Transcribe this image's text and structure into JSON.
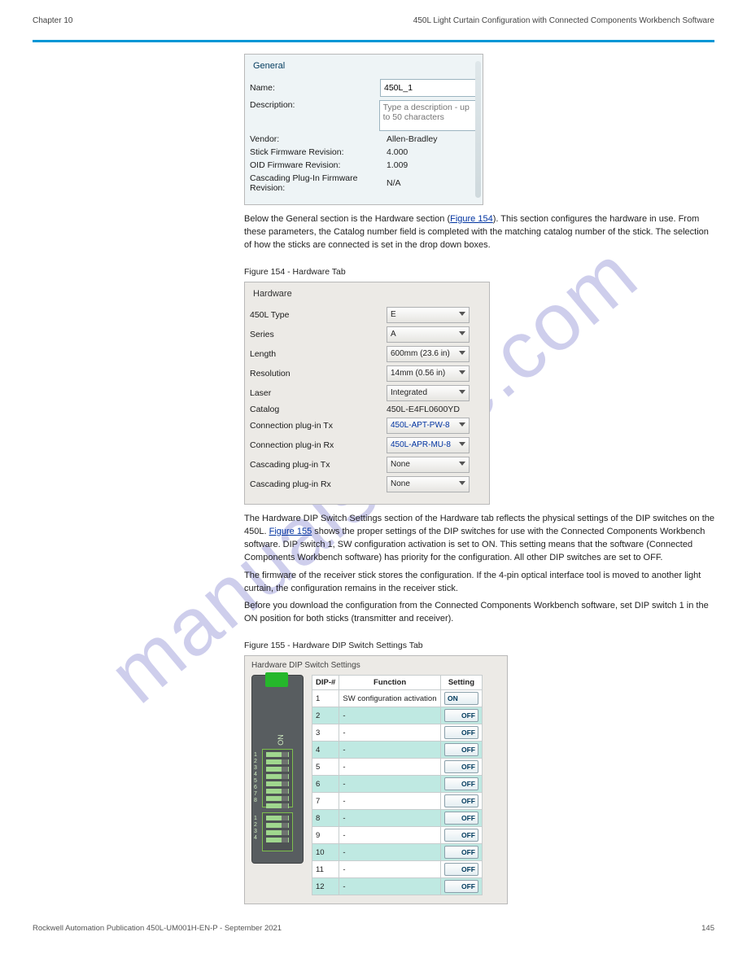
{
  "header": {
    "left": "Chapter 10",
    "right": "450L Light Curtain Configuration with Connected Components Workbench Software"
  },
  "watermark": "manualshive.com",
  "general_panel": {
    "group": "General",
    "name_label": "Name:",
    "name_value": "450L_1",
    "desc_label": "Description:",
    "desc_placeholder": "Type a description - up to 50 characters",
    "rows": [
      {
        "label": "Vendor:",
        "value": "Allen-Bradley"
      },
      {
        "label": "Stick Firmware Revision:",
        "value": "4.000"
      },
      {
        "label": "OID Firmware Revision:",
        "value": "1.009"
      },
      {
        "label": "Cascading Plug-In Firmware Revision:",
        "value": "N/A"
      }
    ]
  },
  "para1": {
    "prefix": "Below the General section is the Hardware section (",
    "link": "Figure 154",
    "suffix": "). This section configures the hardware in use. From these parameters, the Catalog number field is completed with the matching catalog number of the stick. The selection of how the sticks are connected is set in the drop down boxes."
  },
  "fig154_caption": "Figure 154 - Hardware Tab",
  "hardware_panel": {
    "group": "Hardware",
    "rows": [
      {
        "label": "450L Type",
        "value": "E",
        "type": "select"
      },
      {
        "label": "Series",
        "value": "A",
        "type": "select"
      },
      {
        "label": "Length",
        "value": "600mm (23.6 in)",
        "type": "select"
      },
      {
        "label": "Resolution",
        "value": "14mm (0.56 in)",
        "type": "select"
      },
      {
        "label": "Laser",
        "value": "Integrated",
        "type": "select"
      },
      {
        "label": "Catalog",
        "value": "450L-E4FL0600YD",
        "type": "text"
      },
      {
        "label": "Connection plug-in Tx",
        "value": "450L-APT-PW-8",
        "type": "select",
        "link": true
      },
      {
        "label": "Connection plug-in Rx",
        "value": "450L-APR-MU-8",
        "type": "select",
        "link": true
      },
      {
        "label": "Cascading plug-in Tx",
        "value": "None",
        "type": "select"
      },
      {
        "label": "Cascading plug-in Rx",
        "value": "None",
        "type": "select"
      }
    ]
  },
  "para2": {
    "text1": "The Hardware DIP Switch Settings section of the Hardware tab reflects the physical settings of the DIP switches on the 450L. ",
    "link": "Figure 155",
    "text2": " shows the proper settings of the DIP switches for use with the Connected Components Workbench software. DIP switch 1, SW configuration activation is set to ON. This setting means that the software (Connected Components Workbench software) has priority for the configuration. All other DIP switches are set to OFF.",
    "text3": "The firmware of the receiver stick stores the configuration. If the 4-pin optical interface tool is moved to another light curtain, the configuration remains in the receiver stick.",
    "text4": "Before you download the configuration from the Connected Components Workbench software, set DIP switch 1 in the ON position for both sticks (transmitter and receiver)."
  },
  "fig155_caption": "Figure 155 - Hardware DIP Switch Settings Tab",
  "dip_panel": {
    "title": "Hardware DIP Switch Settings",
    "headers": [
      "DIP-#",
      "Function",
      "Setting"
    ],
    "rows": [
      {
        "n": "1",
        "fn": "SW configuration activation",
        "s": "ON",
        "on": true,
        "alt": false
      },
      {
        "n": "2",
        "fn": "-",
        "s": "OFF",
        "on": false,
        "alt": true
      },
      {
        "n": "3",
        "fn": "-",
        "s": "OFF",
        "on": false,
        "alt": false
      },
      {
        "n": "4",
        "fn": "-",
        "s": "OFF",
        "on": false,
        "alt": true
      },
      {
        "n": "5",
        "fn": "-",
        "s": "OFF",
        "on": false,
        "alt": false
      },
      {
        "n": "6",
        "fn": "-",
        "s": "OFF",
        "on": false,
        "alt": true
      },
      {
        "n": "7",
        "fn": "-",
        "s": "OFF",
        "on": false,
        "alt": false
      },
      {
        "n": "8",
        "fn": "-",
        "s": "OFF",
        "on": false,
        "alt": true
      },
      {
        "n": "9",
        "fn": "-",
        "s": "OFF",
        "on": false,
        "alt": false
      },
      {
        "n": "10",
        "fn": "-",
        "s": "OFF",
        "on": false,
        "alt": true
      },
      {
        "n": "11",
        "fn": "-",
        "s": "OFF",
        "on": false,
        "alt": false
      },
      {
        "n": "12",
        "fn": "-",
        "s": "OFF",
        "on": false,
        "alt": true
      }
    ]
  },
  "footer": {
    "left": "Rockwell Automation Publication 450L-UM001H-EN-P - September 2021",
    "right": "145"
  }
}
